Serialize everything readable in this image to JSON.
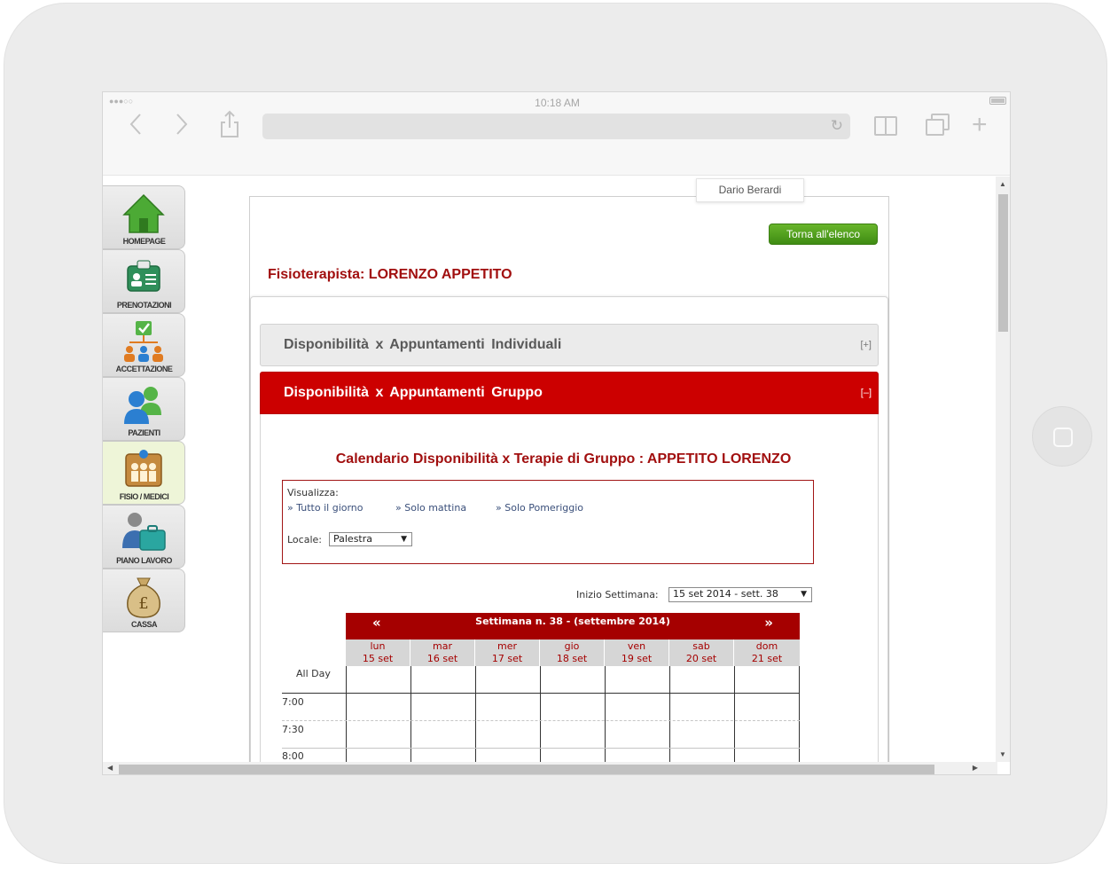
{
  "status_bar": {
    "signal": "●●●○○",
    "time": "10:18 AM"
  },
  "browser": {
    "back_icon": "chevron-left-icon",
    "forward_icon": "chevron-right-icon",
    "share_icon": "share-icon",
    "reload_icon": "reload-icon",
    "bookmarks_icon": "book-icon",
    "tabs_icon": "tabs-icon",
    "new_tab_icon": "plus-icon"
  },
  "sidebar": {
    "items": [
      {
        "label": "HOMEPAGE",
        "icon": "house-icon",
        "active": false
      },
      {
        "label": "PRENOTAZIONI",
        "icon": "id-card-icon",
        "active": false
      },
      {
        "label": "ACCETTAZIONE",
        "icon": "org-chart-icon",
        "active": false
      },
      {
        "label": "PAZIENTI",
        "icon": "people-icon",
        "active": false
      },
      {
        "label": "FISIO / MEDICI",
        "icon": "doctors-icon",
        "active": true
      },
      {
        "label": "PIANO LAVORO",
        "icon": "briefcase-person-icon",
        "active": false
      },
      {
        "label": "CASSA",
        "icon": "money-bag-icon",
        "active": false
      }
    ]
  },
  "user": {
    "name": "Dario Berardi"
  },
  "toolbar": {
    "back_label": "Torna all'elenco"
  },
  "physio": {
    "title": "Fisioterapista: LORENZO APPETITO"
  },
  "accordion": {
    "individual": {
      "title": "Disponibilità x Appuntamenti Individuali",
      "toggle": "[+]"
    },
    "group": {
      "title": "Disponibilità x Appuntamenti Gruppo",
      "toggle": "[–]"
    }
  },
  "calendar": {
    "title": "Calendario Disponibilità x Terapie di Gruppo : APPETITO LORENZO",
    "filters": {
      "label": "Visualizza:",
      "links": [
        "» Tutto il giorno",
        "» Solo mattina",
        "» Solo Pomeriggio"
      ],
      "locale_label": "Locale:",
      "locale_value": "Palestra"
    },
    "week_start_label": "Inizio Settimana:",
    "week_start_value": "15 set 2014 - sett. 38",
    "prev": "«",
    "next": "»",
    "week_title": "Settimana n. 38 - (settembre 2014)",
    "days": [
      {
        "name": "lun",
        "date": "15 set"
      },
      {
        "name": "mar",
        "date": "16 set"
      },
      {
        "name": "mer",
        "date": "17 set"
      },
      {
        "name": "gio",
        "date": "18 set"
      },
      {
        "name": "ven",
        "date": "19 set"
      },
      {
        "name": "sab",
        "date": "20 set"
      },
      {
        "name": "dom",
        "date": "21 set"
      }
    ],
    "allday_label": "All Day",
    "times": [
      "7:00",
      "7:30",
      "8:00"
    ]
  },
  "colors": {
    "accent_red": "#cc0000",
    "title_red": "#a10f0f",
    "green_button": "#4c9a1b"
  }
}
